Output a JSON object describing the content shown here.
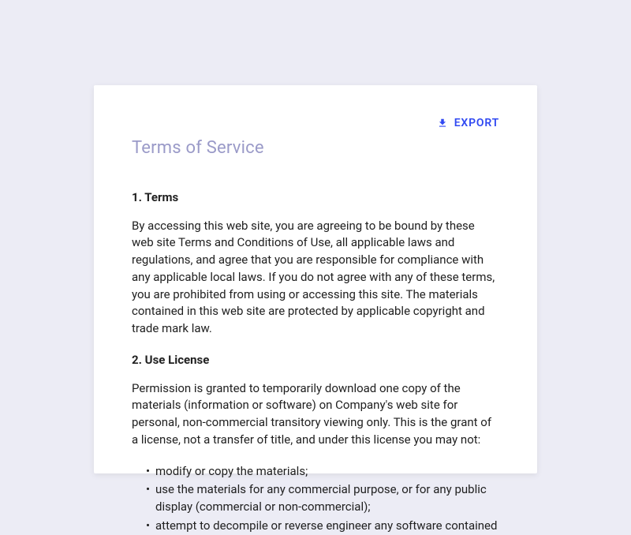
{
  "toolbar": {
    "export_label": "EXPORT"
  },
  "document": {
    "title": "Terms of Service",
    "sections": [
      {
        "heading": "1. Terms",
        "body": "By accessing this web site, you are agreeing to be bound by these web site Terms and Conditions of Use, all applicable laws and regulations, and agree that you are responsible for compliance with any applicable local laws. If you do not agree with any of these terms, you are prohibited from using or accessing this site. The materials contained in this web site are protected by applicable copyright and trade mark law."
      },
      {
        "heading": "2. Use License",
        "body": "Permission is granted to temporarily download one copy of the materials (information or software) on Company's web site for personal, non-commercial transitory viewing only. This is the grant of a license, not a transfer of title, and under this license you may not:",
        "bullets": [
          "modify or copy the materials;",
          "use the materials for any commercial purpose, or for any public display (commercial or non-commercial);",
          "attempt to decompile or reverse engineer any software contained"
        ]
      }
    ]
  },
  "colors": {
    "page_bg": "#ECECF5",
    "card_bg": "#FFFFFF",
    "title": "#9A9AC8",
    "text": "#212121",
    "accent": "#3049F2"
  }
}
